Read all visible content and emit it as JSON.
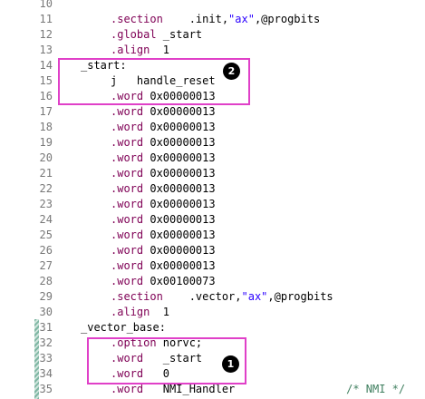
{
  "lines": [
    {
      "n": "10",
      "code": ""
    },
    {
      "n": "11",
      "code": "    .section    .init,\"ax\",@progbits"
    },
    {
      "n": "12",
      "code": "    .global _start"
    },
    {
      "n": "13",
      "code": "    .align  1"
    },
    {
      "n": "14",
      "code": "_start:"
    },
    {
      "n": "15",
      "code": "    j   handle_reset"
    },
    {
      "n": "16",
      "code": "    .word 0x00000013"
    },
    {
      "n": "17",
      "code": "    .word 0x00000013"
    },
    {
      "n": "18",
      "code": "    .word 0x00000013"
    },
    {
      "n": "19",
      "code": "    .word 0x00000013"
    },
    {
      "n": "20",
      "code": "    .word 0x00000013"
    },
    {
      "n": "21",
      "code": "    .word 0x00000013"
    },
    {
      "n": "22",
      "code": "    .word 0x00000013"
    },
    {
      "n": "23",
      "code": "    .word 0x00000013"
    },
    {
      "n": "24",
      "code": "    .word 0x00000013"
    },
    {
      "n": "25",
      "code": "    .word 0x00000013"
    },
    {
      "n": "26",
      "code": "    .word 0x00000013"
    },
    {
      "n": "27",
      "code": "    .word 0x00000013"
    },
    {
      "n": "28",
      "code": "    .word 0x00100073"
    },
    {
      "n": "29",
      "code": "    .section    .vector,\"ax\",@progbits"
    },
    {
      "n": "30",
      "code": "    .align  1"
    },
    {
      "n": "31",
      "code": "_vector_base:"
    },
    {
      "n": "32",
      "code": "    .option norvc;"
    },
    {
      "n": "33",
      "code": "    .word   _start"
    },
    {
      "n": "34",
      "code": "    .word   0"
    },
    {
      "n": "35",
      "code": "    .word   NMI_Handler                 /* NMI */"
    }
  ],
  "annotations": {
    "badge_start": "2",
    "badge_vector": "1"
  },
  "colors": {
    "highlight_box": "#e040c8",
    "keyword": "#7f0055",
    "string": "#2a00ff",
    "comment": "#3f7f5f",
    "current_line": "#e8f2fe"
  }
}
